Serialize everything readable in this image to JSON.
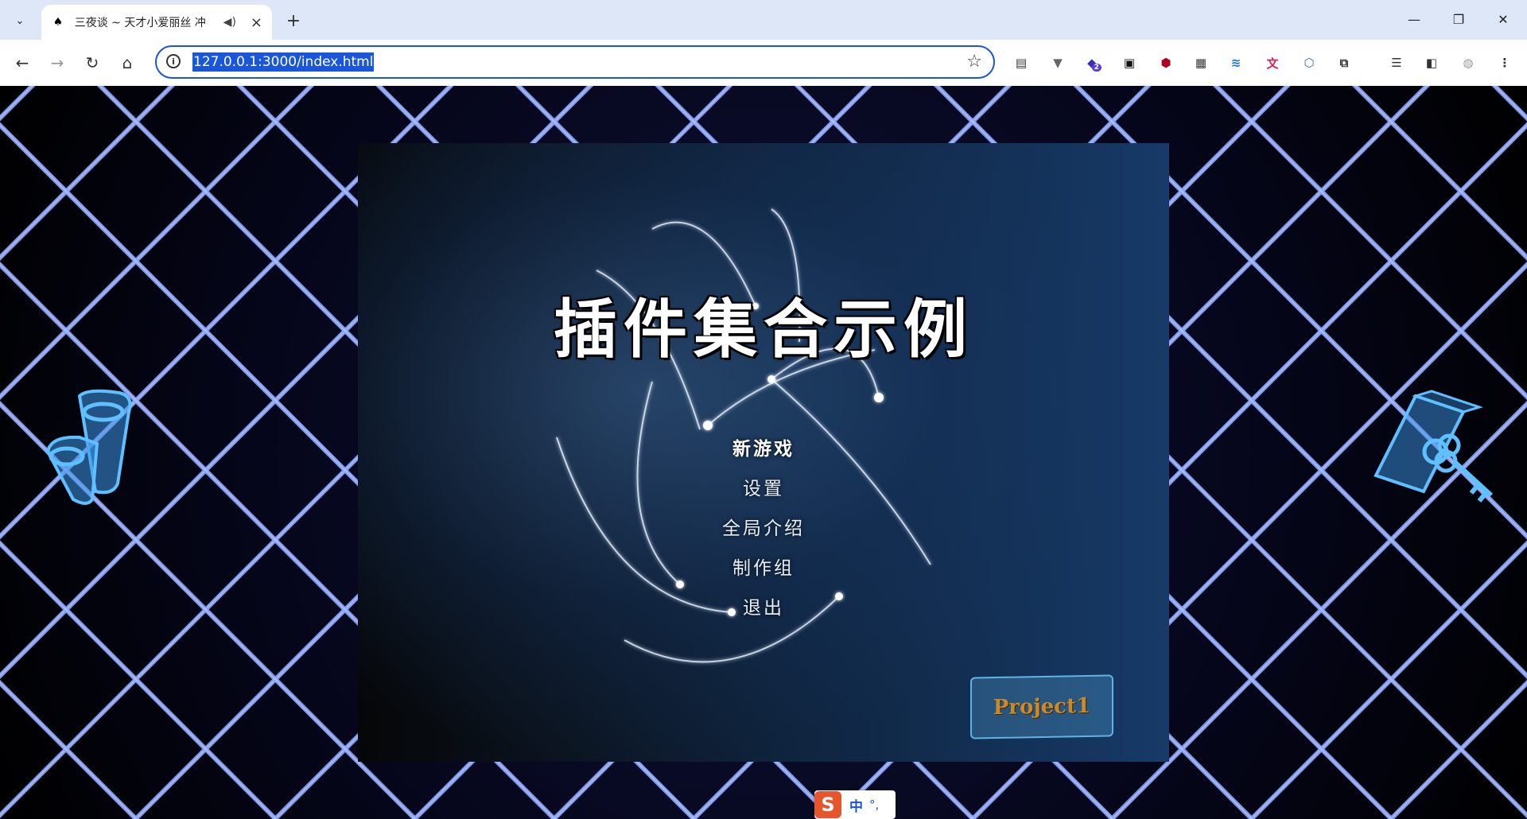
{
  "browser": {
    "tab": {
      "title": "三夜谈 ~ 天才小爱丽丝 冲",
      "favicon": "game-favicon-icon"
    },
    "address": {
      "url": "127.0.0.1:3000/index.html"
    },
    "window_controls": [
      "minimize-icon",
      "restore-icon",
      "close-icon"
    ],
    "extensions": [
      "ext-1",
      "ext-vue",
      "ext-badge",
      "ext-dark",
      "ext-ublock",
      "ext-qr",
      "ext-sync",
      "ext-translate",
      "ext-cube",
      "puzzle-icon",
      "playlist-icon",
      "side-panel-icon",
      "profile-avatar",
      "more-icon"
    ],
    "ext_badge_count": "2"
  },
  "game": {
    "title": "插件集合示例",
    "menu": [
      {
        "label": "新游戏"
      },
      {
        "label": "设置"
      },
      {
        "label": "全局介绍"
      },
      {
        "label": "制作组"
      },
      {
        "label": "退出"
      }
    ],
    "logo": "Project1"
  },
  "ime": {
    "lang": "中",
    "punct": "°,"
  },
  "colors": {
    "accent": "#1a56db",
    "grid": "#7896ff",
    "logo_frame": "#5fb3e6"
  }
}
